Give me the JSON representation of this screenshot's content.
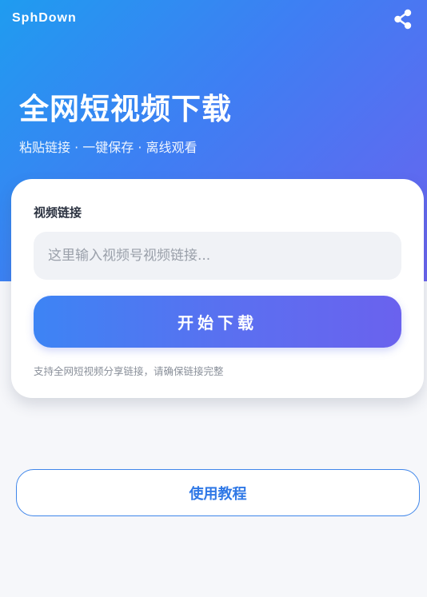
{
  "app": {
    "brand": "SphDown"
  },
  "hero": {
    "title": "全网短视频下载",
    "subtitle": "粘贴链接 · 一键保存 · 离线观看"
  },
  "icons": {
    "share": "share-icon"
  },
  "form": {
    "label": "视频链接",
    "input_placeholder": "这里输入视频号视频链接...",
    "input_value": "",
    "submit_label": "开始下载",
    "hint": "支持全网短视频分享链接，请确保链接完整"
  },
  "footer": {
    "tutorial_label": "使用教程"
  },
  "colors": {
    "hero_gradient_start": "#1f9cf0",
    "hero_gradient_end": "#6a63ef",
    "accent": "#3f86ea",
    "page_bg": "#f6f7fa"
  }
}
